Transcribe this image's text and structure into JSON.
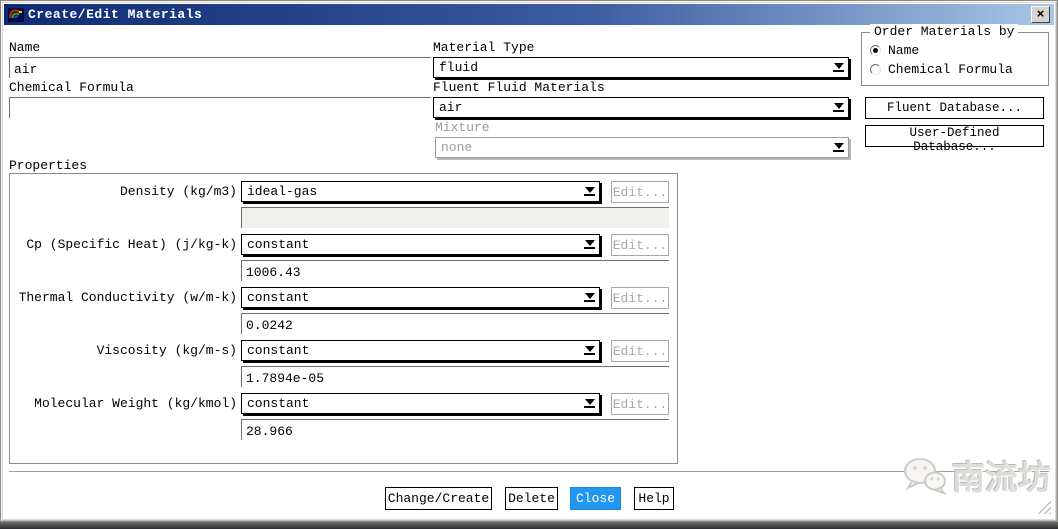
{
  "window": {
    "title": "Create/Edit Materials",
    "close_label": "×"
  },
  "fields": {
    "name": {
      "label": "Name",
      "value": "air"
    },
    "chemical_formula": {
      "label": "Chemical Formula",
      "value": ""
    },
    "material_type": {
      "label": "Material Type",
      "value": "fluid"
    },
    "fluent_fluid_materials": {
      "label": "Fluent Fluid Materials",
      "value": "air"
    },
    "mixture": {
      "label": "Mixture",
      "value": "none",
      "disabled": true
    }
  },
  "order_materials_by": {
    "title": "Order Materials by",
    "options": [
      {
        "label": "Name",
        "selected": true
      },
      {
        "label": "Chemical Formula",
        "selected": false
      }
    ]
  },
  "database_buttons": {
    "fluent": "Fluent Database...",
    "user_defined": "User-Defined Database..."
  },
  "properties": {
    "title": "Properties",
    "edit_label": "Edit...",
    "rows": [
      {
        "label": "Density (kg/m3)",
        "method": "ideal-gas",
        "value": "",
        "value_disabled": true
      },
      {
        "label": "Cp (Specific Heat) (j/kg-k)",
        "method": "constant",
        "value": "1006.43",
        "value_disabled": false
      },
      {
        "label": "Thermal Conductivity (w/m-k)",
        "method": "constant",
        "value": "0.0242",
        "value_disabled": false
      },
      {
        "label": "Viscosity (kg/m-s)",
        "method": "constant",
        "value": "1.7894e-05",
        "value_disabled": false
      },
      {
        "label": "Molecular Weight (kg/kmol)",
        "method": "constant",
        "value": "28.966",
        "value_disabled": false
      }
    ]
  },
  "footer_buttons": {
    "change_create": "Change/Create",
    "delete": "Delete",
    "close": "Close",
    "help": "Help"
  },
  "watermark": {
    "text": "南流坊"
  },
  "icons": {
    "titlebar": "fluent-logo-icon",
    "close": "close-icon",
    "combo_arrow": "chevron-down-icon",
    "watermark": "wechat-icon",
    "resize": "resize-grip-icon"
  },
  "colors": {
    "close_button_bg": "#2196f3",
    "titlebar_gradient_start": "#0e2a74",
    "titlebar_gradient_end": "#a8c6e6",
    "disabled_gray": "#9a9a9a"
  }
}
